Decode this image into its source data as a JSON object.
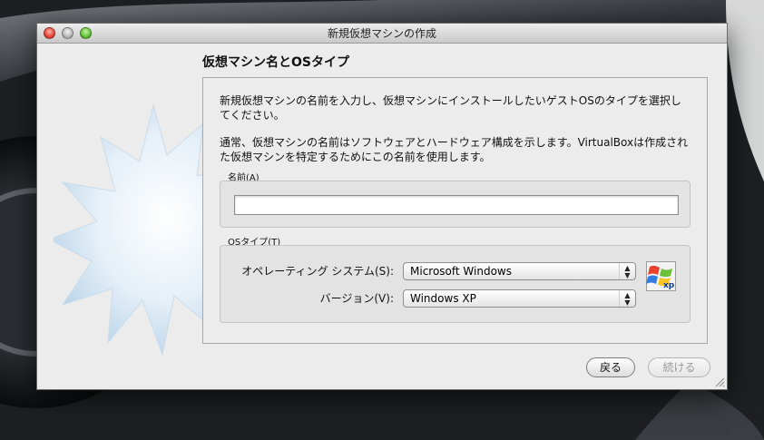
{
  "window": {
    "title": "新規仮想マシンの作成"
  },
  "page": {
    "heading": "仮想マシン名とOSタイプ",
    "description_1": "新規仮想マシンの名前を入力し、仮想マシンにインストールしたいゲストOSのタイプを選択してください。",
    "description_2": "通常、仮想マシンの名前はソフトウェアとハードウェア構成を示します。VirtualBoxは作成された仮想マシンを特定するためにこの名前を使用します。"
  },
  "name_group": {
    "label": "名前(A)",
    "value": ""
  },
  "os_group": {
    "label": "OSタイプ(T)",
    "os_label": "オペレーティング システム(S):",
    "os_value": "Microsoft Windows",
    "version_label": "バージョン(V):",
    "version_value": "Windows XP",
    "icon": "windows-xp-icon",
    "icon_text": "xp"
  },
  "buttons": {
    "back": "戻る",
    "next": "続ける"
  },
  "colors": {
    "window_bg": "#ececec",
    "starburst": "#cfe3f2"
  }
}
